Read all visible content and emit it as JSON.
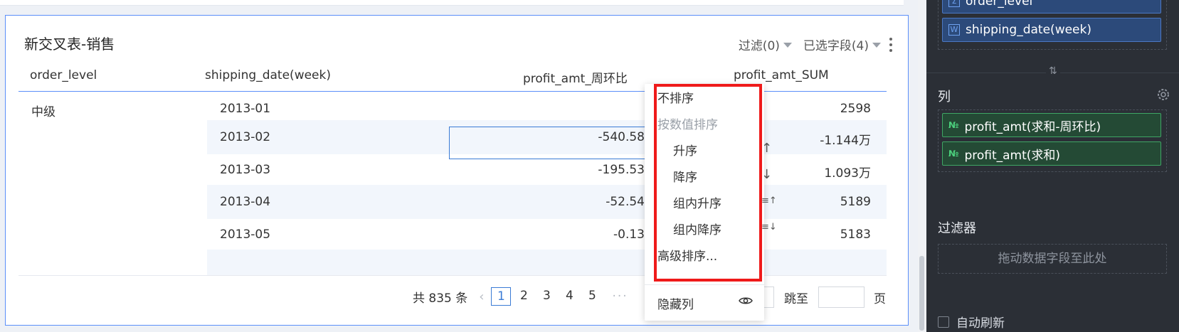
{
  "widget": {
    "title": "新交叉表-销售",
    "filter_label": "过滤(0)",
    "fields_label": "已选字段(4)"
  },
  "table": {
    "columns": [
      "order_level",
      "shipping_date(week)",
      "profit_amt_周环比",
      "profit_amt_SUM"
    ],
    "group_value": "中级",
    "rows": [
      {
        "date": "2013-01",
        "wow": "",
        "sum": "2598"
      },
      {
        "date": "2013-02",
        "wow": "-540.58",
        "sum": "-1.144万"
      },
      {
        "date": "2013-03",
        "wow": "-195.53",
        "sum": "1.093万"
      },
      {
        "date": "2013-04",
        "wow": "-52.54",
        "sum": "5189"
      },
      {
        "date": "2013-05",
        "wow": "-0.13",
        "sum": "5183"
      }
    ]
  },
  "pagination": {
    "total": "共 835 条",
    "pages": [
      "1",
      "2",
      "3",
      "4",
      "5"
    ],
    "active_page": "1",
    "more": "···",
    "jump_label": "跳至",
    "page_unit": "页"
  },
  "context_menu": {
    "no_sort": "不排序",
    "sort_by_value": "按数值排序",
    "asc": "升序",
    "desc": "降序",
    "group_asc": "组内升序",
    "group_desc": "组内降序",
    "advanced": "高级排序...",
    "hide_column": "隐藏列",
    "asc_icon": "↑",
    "desc_icon": "↓",
    "group_asc_icon": "≡↑",
    "group_desc_icon": "≡↓"
  },
  "side_panel": {
    "top_field_partial": "order_level",
    "top_field_badge": "Σ",
    "row_field": "shipping_date(week)",
    "row_field_badge": "W",
    "columns_title": "列",
    "col_fields": [
      {
        "label": "profit_amt(求和-周环比)",
        "badge": "№"
      },
      {
        "label": "profit_amt(求和)",
        "badge": "№"
      }
    ],
    "filter_title": "过滤器",
    "dropzone_text": "拖动数据字段至此处",
    "auto_refresh": "自动刷新"
  },
  "colors": {
    "accent_blue": "#3a7bd5",
    "highlight_red": "#ef1a1a",
    "panel_bg": "#2b2f36",
    "measure_green": "#3fa664"
  }
}
